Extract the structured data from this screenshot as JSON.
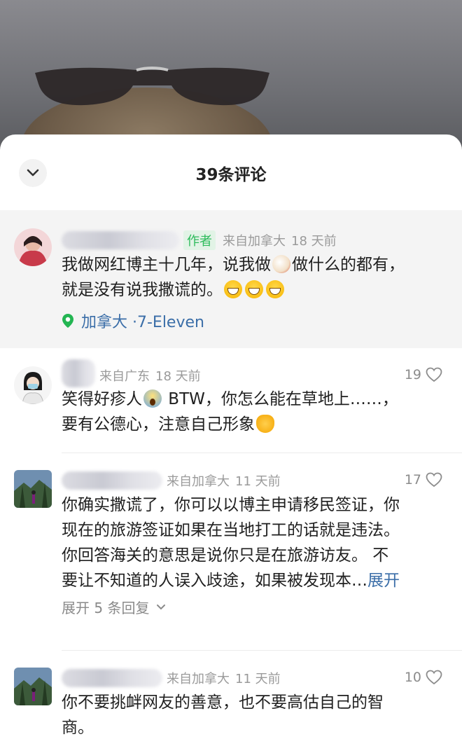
{
  "sheet": {
    "title": "39条评论",
    "collapse_icon": "chevron-down-icon"
  },
  "comments": [
    {
      "author_tag": "作者",
      "location_time": "来自加拿大",
      "time": "18 天前",
      "line1_a": "我做网红博主十几年，说我做",
      "line1_b": "做什么的都有，",
      "line2": "就是没有说我撒谎的。",
      "place": "加拿大 ·7-Eleven"
    },
    {
      "location_time": "来自广东",
      "time": "18 天前",
      "likes": "19",
      "line1_a": "笑得好疹人",
      "line1_b": " BTW，你怎么能在草地上……，",
      "line2": "要有公德心，注意自己形象"
    },
    {
      "location_time": "来自加拿大",
      "time": "11 天前",
      "likes": "17",
      "line1": "你确实撒谎了，你可以以博主申请移民签证，你",
      "line2": "现在的旅游签证如果在当地打工的话就是违法。",
      "line3": "你回答海关的意思是说你只是在旅游访友。 不",
      "line4": "要让不知道的人误入歧途，如果被发现本…",
      "expand": "展开",
      "replies": "展开 5 条回复"
    },
    {
      "location_time": "来自加拿大",
      "time": "11 天前",
      "likes": "10",
      "line1": "你不要挑衅网友的善意，也不要高估自己的智",
      "line2": "商。"
    }
  ]
}
